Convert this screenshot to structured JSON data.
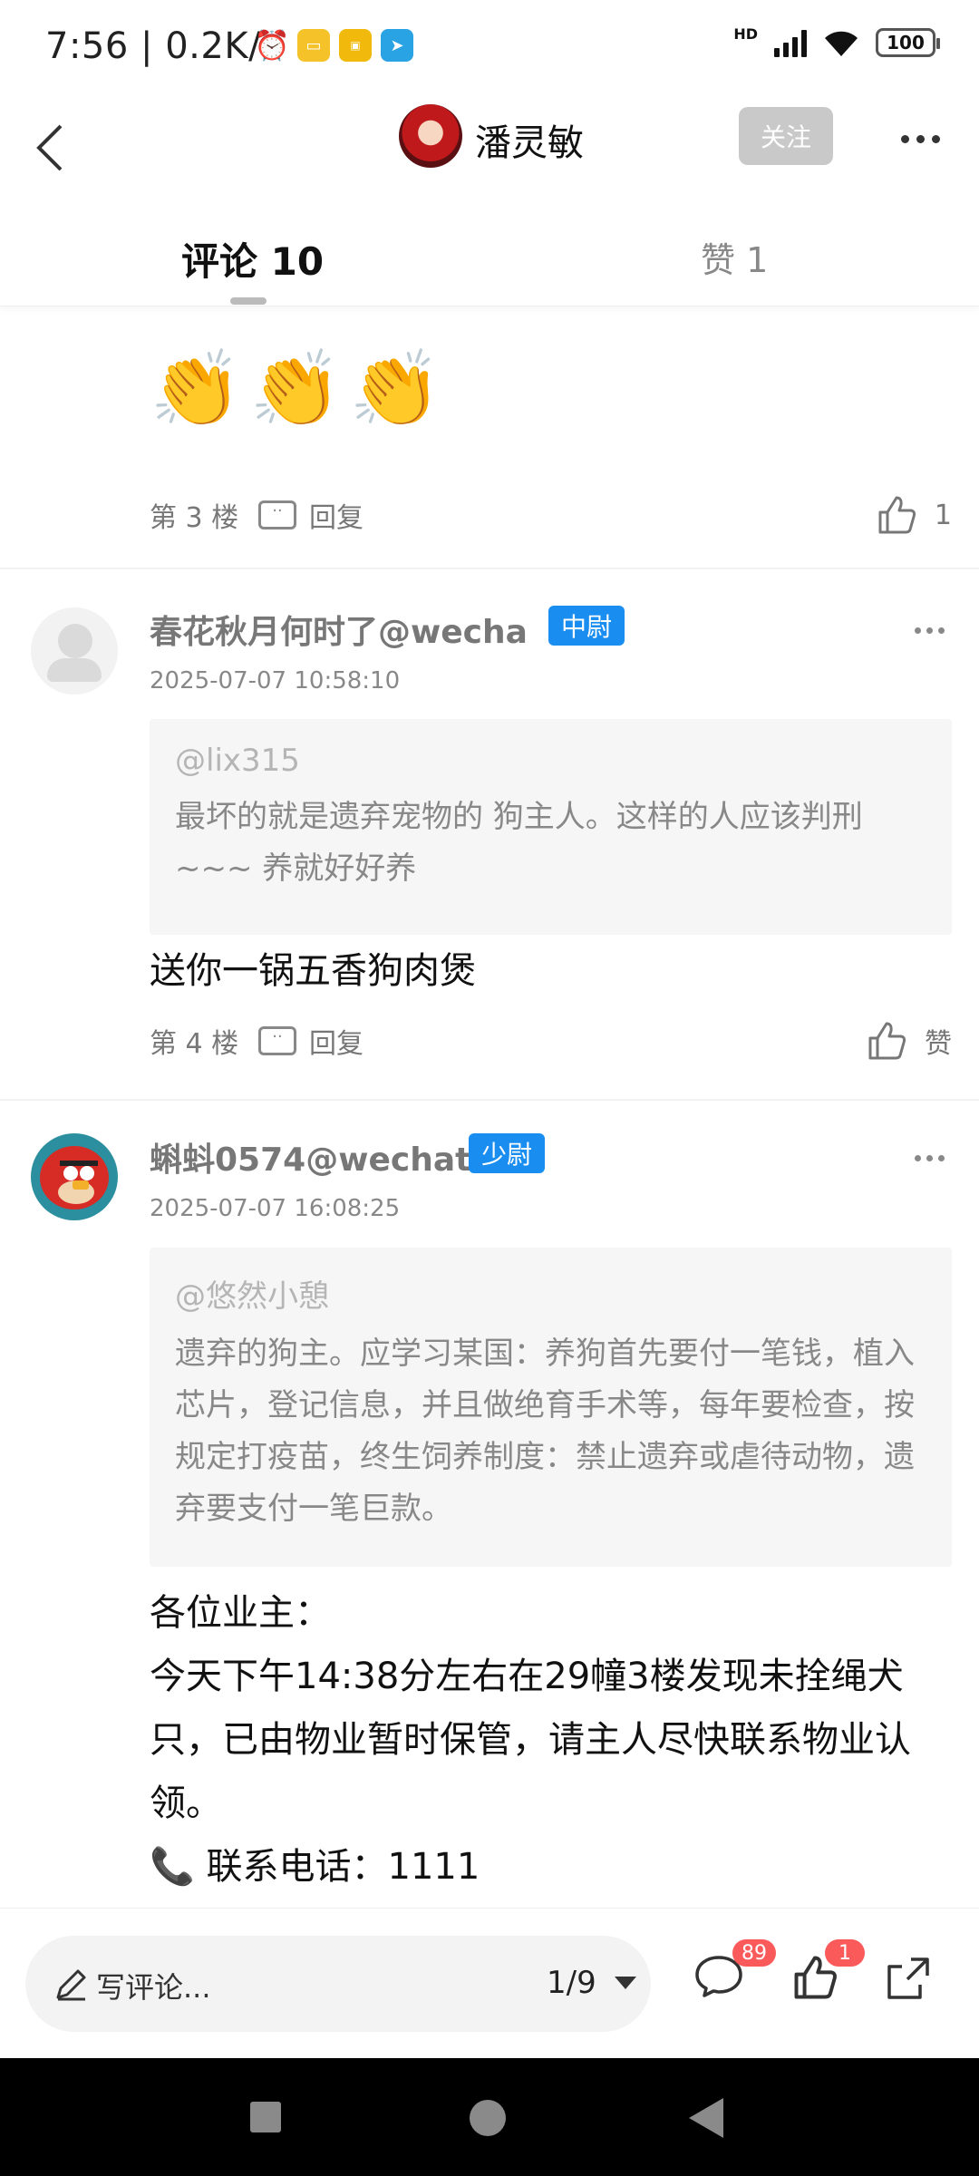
{
  "status_bar": {
    "time": "7:56 | 0.2K/s",
    "network": "HD",
    "battery": "100"
  },
  "header": {
    "user_name": "潘灵敏",
    "follow_label": "关注"
  },
  "tabs": {
    "comments": "评论 10",
    "likes": "赞 1"
  },
  "comments": [
    {
      "floor": "第 3 楼",
      "reply": "回复",
      "likes": "1"
    },
    {
      "author": "春花秋月何时了@wecha",
      "rank": "中尉",
      "timestamp": "2025-07-07 10:58:10",
      "quote_user": "@lix315",
      "quote_text": "最坏的就是遗弃宠物的 狗主人。这样的人应该判刑~~~ 养就好好养",
      "text": "送你一锅五香狗肉煲",
      "floor": "第 4 楼",
      "reply": "回复",
      "likes": "赞"
    },
    {
      "author": "蝌蚪0574@wechat",
      "rank": "少尉",
      "timestamp": "2025-07-07 16:08:25",
      "quote_user": "@悠然小憩",
      "quote_text": "遗弃的狗主。应学习某国：养狗首先要付一笔钱，植入芯片，登记信息，并且做绝育手术等，每年要检查，按规定打疫苗，终生饲养制度：禁止遗弃或虐待动物，遗弃要支付一笔巨款。",
      "text_line1": "各位业主：",
      "text_line2": "今天下午14:38分左右在29幢3楼发现未拴绳犬只，已由物业暂时保管，请主人尽快联系物业认领。",
      "text_line3": "📞 联系电话：1111"
    }
  ],
  "bottom_bar": {
    "write_placeholder": "写评论...",
    "page": "1/9",
    "comment_count": "89",
    "like_count": "1"
  },
  "colors": {
    "rank_badge": "#1a8df0",
    "count_badge": "#fb5a5a"
  }
}
